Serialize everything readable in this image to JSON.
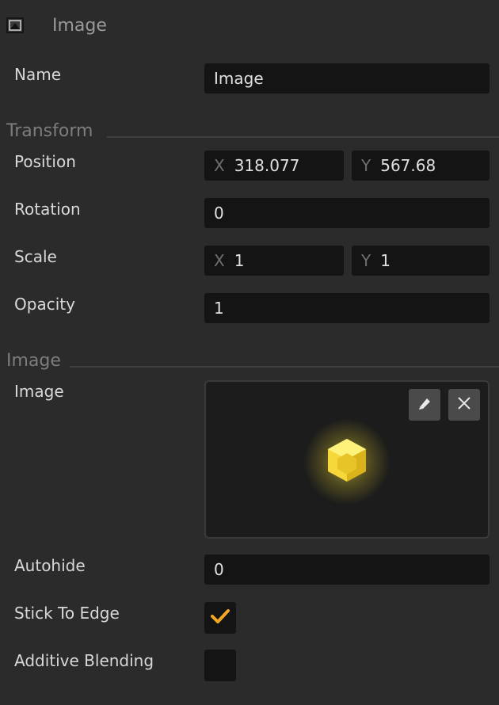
{
  "header": {
    "title": "Image",
    "icon": "image-component-icon"
  },
  "name_row": {
    "label": "Name",
    "value": "Image"
  },
  "transform": {
    "section_title": "Transform",
    "position": {
      "label": "Position",
      "x_axis": "X",
      "x": "318.077",
      "y_axis": "Y",
      "y": "567.68"
    },
    "rotation": {
      "label": "Rotation",
      "value": "0"
    },
    "scale": {
      "label": "Scale",
      "x_axis": "X",
      "x": "1",
      "y_axis": "Y",
      "y": "1"
    },
    "opacity": {
      "label": "Opacity",
      "value": "1"
    }
  },
  "image_section": {
    "section_title": "Image",
    "image": {
      "label": "Image",
      "edit_icon": "pencil-icon",
      "clear_icon": "close-icon",
      "preview": "glowing-yellow-cube"
    },
    "autohide": {
      "label": "Autohide",
      "value": "0"
    },
    "stick_to_edge": {
      "label": "Stick To Edge",
      "checked": true
    },
    "additive_blending": {
      "label": "Additive Blending",
      "checked": false
    }
  },
  "colors": {
    "background": "#2b2b2b",
    "field": "#141414",
    "accent": "#f5a623"
  }
}
